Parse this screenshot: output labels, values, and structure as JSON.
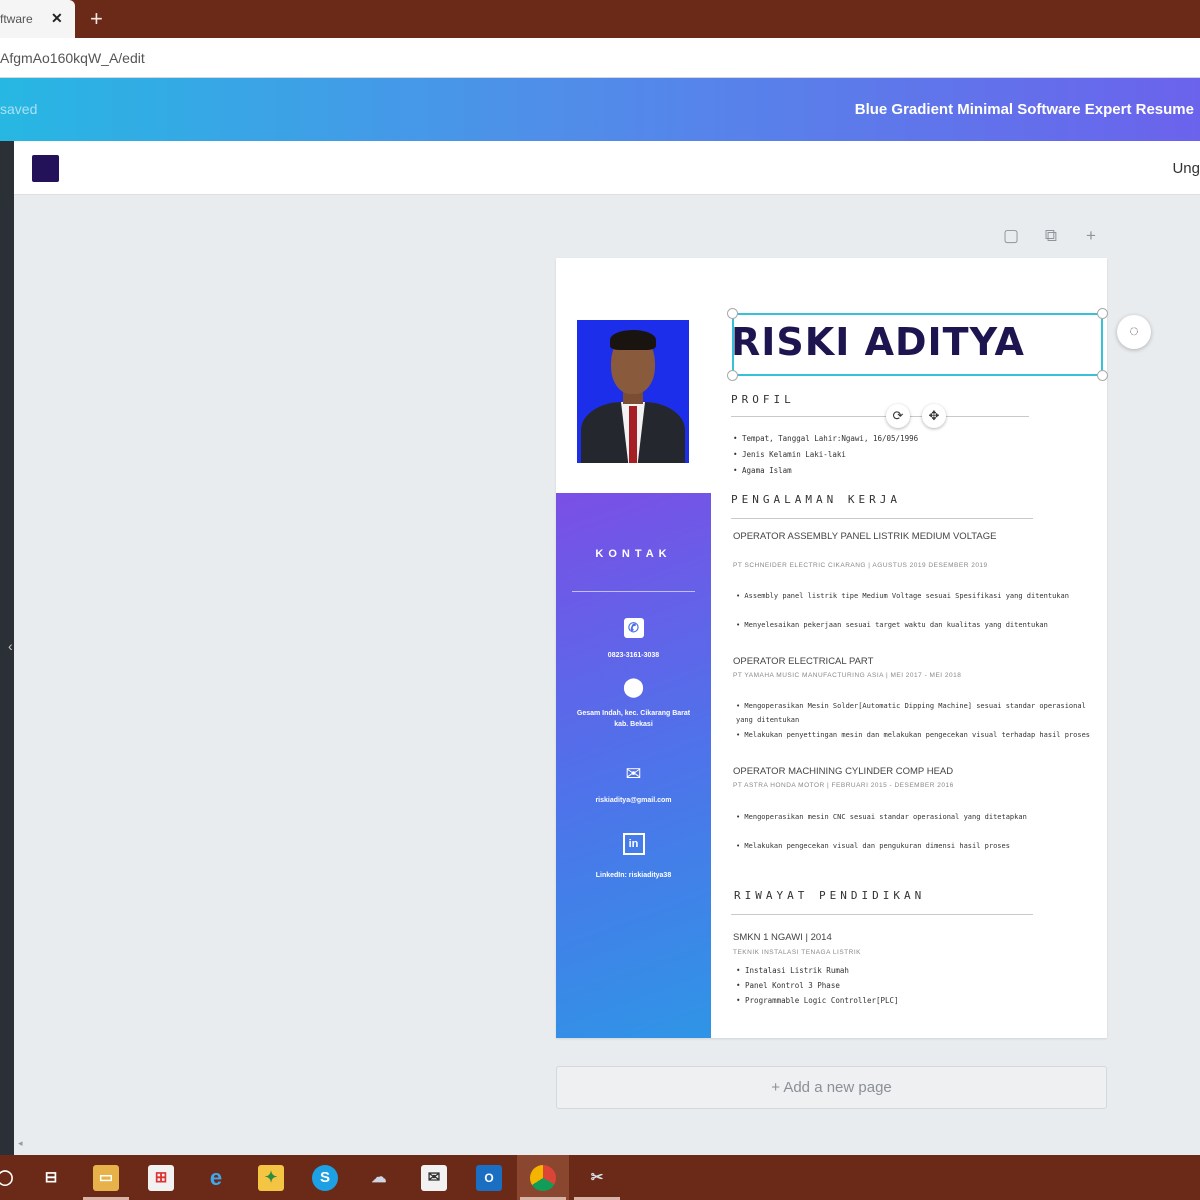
{
  "browser": {
    "tab_title": "ftware",
    "tab_close": "✕",
    "tab_new": "+",
    "url": "AfgmAo160kqW_A/edit"
  },
  "editor": {
    "saved_label": "saved",
    "doc_title": "Blue Gradient Minimal Software Expert Resume",
    "toolbar_right": "Ung",
    "collapse_glyph": "‹",
    "add_page": "+ Add a new page",
    "swatch_color": "#23125a"
  },
  "resume": {
    "name": "RISKI ADITYA",
    "profil_heading": "PROFIL",
    "profil_items": [
      "• Tempat, Tanggal Lahir:Ngawi, 16/05/1996",
      "• Jenis Kelamin  Laki-laki",
      "• Agama  Islam"
    ],
    "pengalaman_heading": "PENGALAMAN KERJA",
    "jobs": [
      {
        "title": "OPERATOR ASSEMBLY PANEL LISTRIK MEDIUM VOLTAGE",
        "meta": "PT SCHNEIDER ELECTRIC CIKARANG | AGUSTUS 2019 DESEMBER 2019",
        "bullets": [
          "• Assembly panel listrik tipe Medium Voltage sesuai Spesifikasi yang ditentukan",
          "• Menyelesaikan pekerjaan sesuai target waktu dan kualitas yang ditentukan"
        ]
      },
      {
        "title": "OPERATOR ELECTRICAL PART",
        "meta": "PT YAMAHA MUSIC MANUFACTURING ASIA | MEI 2017 - MEI 2018",
        "bullets": [
          "• Mengoperasikan Mesin Solder[Automatic Dipping Machine] sesuai standar operasional yang ditentukan",
          "• Melakukan penyettingan mesin dan melakukan pengecekan visual terhadap hasil proses"
        ]
      },
      {
        "title": "OPERATOR MACHINING CYLINDER COMP HEAD",
        "meta": "PT ASTRA HONDA MOTOR | FEBRUARI 2015 - DESEMBER 2016",
        "bullets": [
          "• Mengoperasikan mesin CNC sesuai standar operasional yang ditetapkan",
          "• Melakukan pengecekan visual dan pengukuran dimensi hasil proses"
        ]
      }
    ],
    "pendidikan_heading": "RIWAYAT PENDIDIKAN",
    "school": "SMKN 1 NGAWI | 2014",
    "school_meta": "TEKNIK INSTALASI TENAGA LISTRIK",
    "school_items": [
      "• Instalasi Listrik Rumah",
      "• Panel Kontrol 3 Phase",
      "• Programmable Logic Controller[PLC]"
    ],
    "kontak_heading": "KONTAK",
    "contacts": {
      "phone": "0823-3161-3038",
      "address": "Gesam Indah, kec. Cikarang Barat kab. Bekasi",
      "email": "riskiaditya@gmail.com",
      "linkedin": "LinkedIn: riskiaditya38"
    }
  },
  "taskbar": {
    "icons": [
      "windows-logo",
      "task-view",
      "file-explorer",
      "store",
      "edge",
      "folder",
      "skype",
      "paint",
      "mail",
      "outlook",
      "chrome",
      "snipping-tool"
    ]
  }
}
